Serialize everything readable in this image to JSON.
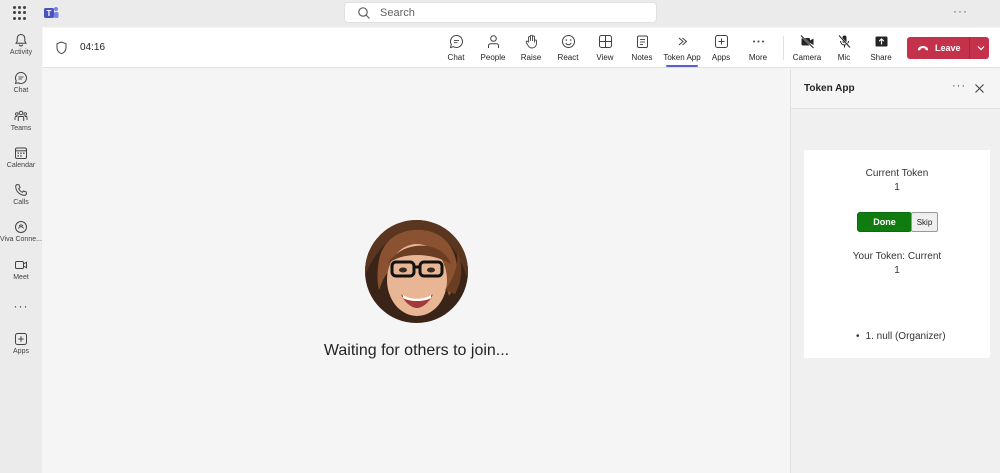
{
  "titlebar": {
    "search_placeholder": "Search",
    "more": "···"
  },
  "rail": {
    "items": [
      {
        "label": "Activity",
        "icon": "bell-icon"
      },
      {
        "label": "Chat",
        "icon": "chat-icon"
      },
      {
        "label": "Teams",
        "icon": "teams-icon"
      },
      {
        "label": "Calendar",
        "icon": "calendar-icon"
      },
      {
        "label": "Calls",
        "icon": "phone-icon"
      },
      {
        "label": "Viva Conne...",
        "icon": "viva-connections-icon"
      },
      {
        "label": "Meet",
        "icon": "video-icon"
      },
      {
        "label": "Apps",
        "icon": "add-apps-icon"
      }
    ],
    "more": "···"
  },
  "toolbar": {
    "timer": "04:16",
    "buttons": [
      {
        "label": "Chat",
        "icon": "chat-icon"
      },
      {
        "label": "People",
        "icon": "people-icon"
      },
      {
        "label": "Raise",
        "icon": "hand-icon"
      },
      {
        "label": "React",
        "icon": "smile-icon"
      },
      {
        "label": "View",
        "icon": "grid-icon"
      },
      {
        "label": "Notes",
        "icon": "notes-icon"
      },
      {
        "label": "Token App",
        "icon": "token-app-icon"
      },
      {
        "label": "Apps",
        "icon": "add-icon"
      },
      {
        "label": "More",
        "icon": "more-icon"
      },
      {
        "label": "Camera",
        "icon": "camera-off-icon"
      },
      {
        "label": "Mic",
        "icon": "mic-off-icon"
      },
      {
        "label": "Share",
        "icon": "share-icon"
      }
    ],
    "leave_label": "Leave",
    "leave_color": "#c4314b",
    "active_tab_color": "#5b5fc7"
  },
  "stage": {
    "waiting_text": "Waiting for others to join..."
  },
  "panel": {
    "title": "Token App",
    "more": "···",
    "current_token_label": "Current Token",
    "current_token_value": "1",
    "done_label": "Done",
    "skip_label": "Skip",
    "your_token_label": "Your Token: Current",
    "your_token_value": "1",
    "queue": [
      "1. null (Organizer)"
    ],
    "done_color": "#107c10"
  }
}
